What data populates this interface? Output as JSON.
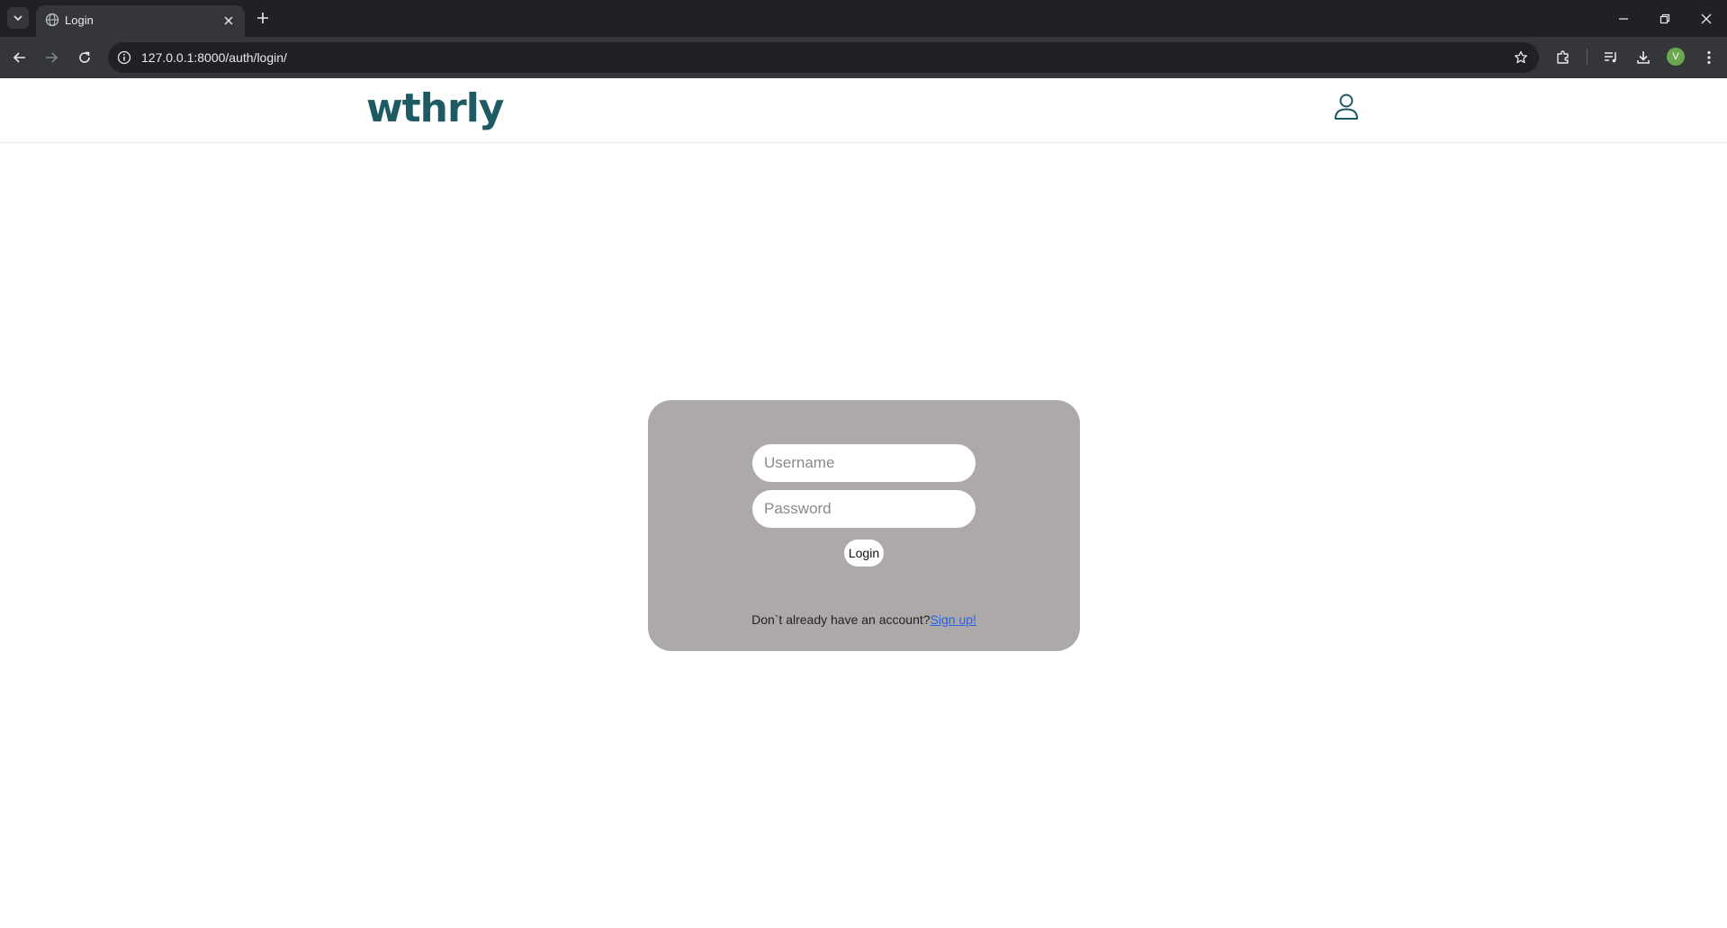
{
  "browser": {
    "tab_title": "Login",
    "url": "127.0.0.1:8000/auth/login/",
    "profile_initial": "V",
    "profile_color": "#6aa84f"
  },
  "site": {
    "logo": "wthrly",
    "brand_color": "#1e5a63"
  },
  "login": {
    "username_placeholder": "Username",
    "password_placeholder": "Password",
    "login_label": "Login",
    "signup_prompt": "Don`t already have an account?",
    "signup_link": "Sign up!",
    "card_color": "#ada9a9"
  }
}
